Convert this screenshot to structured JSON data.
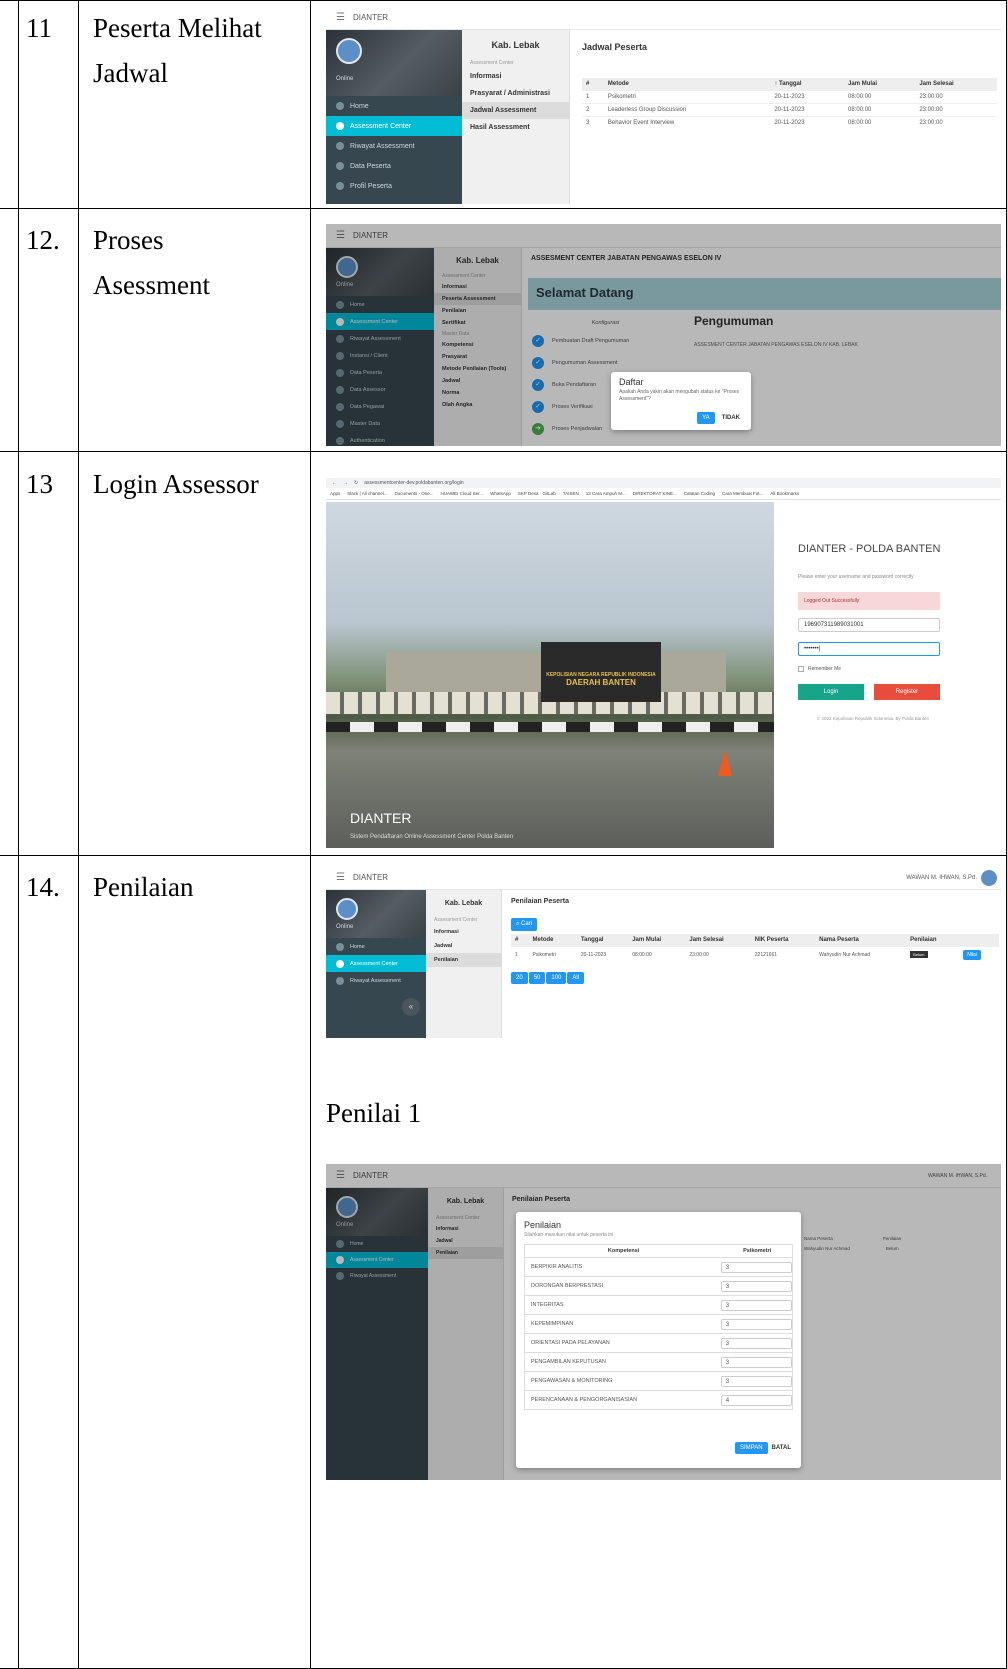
{
  "rows": [
    {
      "num": "11",
      "title": "Peserta Melihat Jadwal"
    },
    {
      "num": "12.",
      "title": "Proses Asessment"
    },
    {
      "num": "13",
      "title": "Login Assessor"
    },
    {
      "num": "14.",
      "title": "Penilaian"
    }
  ],
  "caption_penilai": "Penilai 1",
  "app": {
    "name": "DIANTER",
    "online": "Online",
    "region": "Kab. Lebak",
    "section_caption": "Assessment Center",
    "master_caption": "Master Data",
    "user": "WAWAN M. IHWAN, S.Pd."
  },
  "shot1": {
    "sidebar": [
      "Home",
      "Assessment Center",
      "Riwayat Assessment",
      "Data Peserta",
      "Profil Peserta"
    ],
    "submenu": [
      "Informasi",
      "Prasyarat / Administrasi",
      "Jadwal Assessment",
      "Hasil Assessment"
    ],
    "page_title": "Jadwal Peserta",
    "columns": [
      "#",
      "Metode",
      "↑ Tanggal",
      "Jam Mulai",
      "Jam Selesai"
    ],
    "rows": [
      [
        "1",
        "Psikometri",
        "20-11-2023",
        "08:00:00",
        "23:00:00"
      ],
      [
        "2",
        "Leaderless Group Discussion",
        "20-11-2023",
        "08:00:00",
        "23:00:00"
      ],
      [
        "3",
        "Behavior Event Interview",
        "20-11-2023",
        "08:00:00",
        "23:00:00"
      ]
    ]
  },
  "shot2": {
    "sidebar": [
      "Home",
      "Assessment Center",
      "Riwayat Assessment",
      "Instansi / Client",
      "Data Peserta",
      "Data Assessor",
      "Data Pegawai",
      "Master Data",
      "Authentication"
    ],
    "submenu_top": [
      "Informasi",
      "Peserta Assessment",
      "Penilaian",
      "Sertifikat"
    ],
    "submenu_master": [
      "Kompetensi",
      "Prasyarat",
      "Metode Penilaian (Tools)",
      "Jadwal",
      "Norma",
      "Olah Angka"
    ],
    "page_title": "ASSESMENT CENTER JABATAN PENGAWAS ESELON IV",
    "welcome": "Selamat Datang",
    "konfigurasi": "Konfigurasi",
    "steps": [
      "Pembuatan Draft Pengumuman",
      "Pengumuman Assessment",
      "Buka Pendaftaran",
      "Proses Verifikasi",
      "Proses Penjadwalan"
    ],
    "pengumuman_title": "Pengumuman",
    "pengumuman_text": "ASSESMENT CENTER JABATAN PENGAWAS ESELON IV KAB. LEBAK",
    "dialog_title": "Daftar",
    "dialog_text": "Apakah Anda yakin akan mengubah status ke \"Proses Assessment\"?",
    "yes": "YA",
    "no": "TIDAK"
  },
  "shot3": {
    "url": "assessmentcenter-dev.poldabanten.org/login",
    "bookmarks": [
      "Apps",
      "Slack | All channel...",
      "Documents - One...",
      "HUAWEI Cloud Ser...",
      "WhatsApp",
      "SKP Desa · GitLab",
      "TAISEN",
      "13 Cara Ampuh M...",
      "DIREKTORAT KINE...",
      "Catatan Coding",
      "Cara Membuat Fot...",
      "All Bookmarks"
    ],
    "sign_top": "KEPOLISIAN NEGARA REPUBLIK INDONESIA",
    "sign_main": "DAERAH BANTEN",
    "title": "DIANTER - POLDA BANTEN",
    "subtitle": "Please enter your username and password correctly",
    "alert": "Logged Out Successfully",
    "username": "196907311989031001",
    "password": "•••••••|",
    "remember": "Remember Me",
    "login": "Login",
    "register": "Register",
    "footer": "© 2022 Kepolisian Republik Indonesia. By Polda Banten",
    "brand": "DIANTER",
    "brand_sub": "Sistem Pendaftaran Online Assessment Center Polda Banten"
  },
  "shot4": {
    "sidebar": [
      "Home",
      "Assessment Center",
      "Riwayat Assessment"
    ],
    "submenu": [
      "Informasi",
      "Jadwal",
      "Penilaian"
    ],
    "page_title": "Penilaian Peserta",
    "search": "Cari",
    "columns": [
      "#",
      "Metode",
      "Tanggal",
      "Jam Mulai",
      "Jam Selesai",
      "NIK Peserta",
      "Nama Peserta",
      "Penilaian"
    ],
    "row": [
      "1",
      "Psikometri",
      "20-11-2023",
      "08:00:00",
      "23:00:00",
      "22121661",
      "Wahyudin Nur Achmad",
      "Belum"
    ],
    "nilai": "Nilai",
    "pager": [
      "20",
      "50",
      "100",
      "All"
    ]
  },
  "shot5": {
    "modal_title": "Penilaian",
    "modal_sub": "Silahkan masukan nilai untuk peserta ini",
    "col_komp": "Kompetensi",
    "col_psiko": "Psikometri",
    "criteria": [
      {
        "name": "BERPIKIR ANALITIS",
        "value": "3"
      },
      {
        "name": "DORONGAN BERPRESTASI",
        "value": "3"
      },
      {
        "name": "INTEGRITAS",
        "value": "3"
      },
      {
        "name": "KEPEMIMPINAN",
        "value": "3"
      },
      {
        "name": "ORIENTASI PADA PELAYANAN",
        "value": "3"
      },
      {
        "name": "PENGAMBILAN KEPUTUSAN",
        "value": "3"
      },
      {
        "name": "PENGAWASAN & MONITORING",
        "value": "3"
      },
      {
        "name": "PERENCANAAN & PENGORGANISASIAN",
        "value": "4"
      }
    ],
    "save": "SIMPAN",
    "cancel": "BATAL",
    "bg_cols": [
      "Nama Peserta",
      "Penilaian"
    ],
    "bg_row": [
      "Wahyudin Nur Achmad",
      "Belum"
    ]
  }
}
